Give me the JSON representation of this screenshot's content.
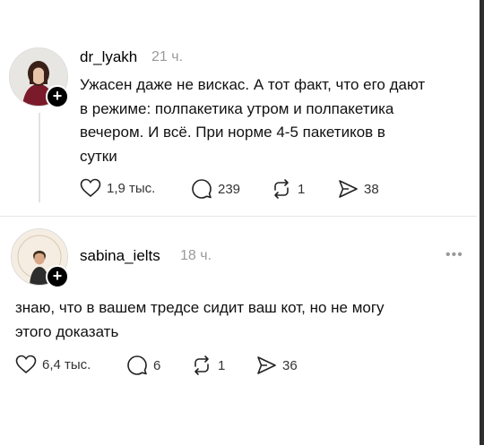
{
  "posts": [
    {
      "username": "dr_lyakh",
      "time": "21 ч.",
      "lines": [
        "Ужасен даже не вискас. А тот факт, что его дают",
        "в режиме: полпакетика утром и полпакетика",
        "вечером. И всё.  При норме 4-5 пакетиков в",
        "сутки"
      ],
      "likes": "1,9 тыс.",
      "comments": "239",
      "reposts": "1",
      "shares": "38"
    },
    {
      "username": "sabina_ielts",
      "time": "18 ч.",
      "lines": [
        "знаю, что в вашем тредсе сидит ваш кот, но не могу",
        "этого доказать"
      ],
      "likes": "6,4 тыс.",
      "comments": "6",
      "reposts": "1",
      "shares": "36",
      "more": "•••"
    }
  ],
  "icons": {
    "follow": "+",
    "like": "heart-icon",
    "comment": "comment-icon",
    "repost": "repost-icon",
    "share": "share-icon"
  },
  "colors": {
    "text": "#111111",
    "muted": "#9a9a9a",
    "line": "#e2e2e2"
  }
}
